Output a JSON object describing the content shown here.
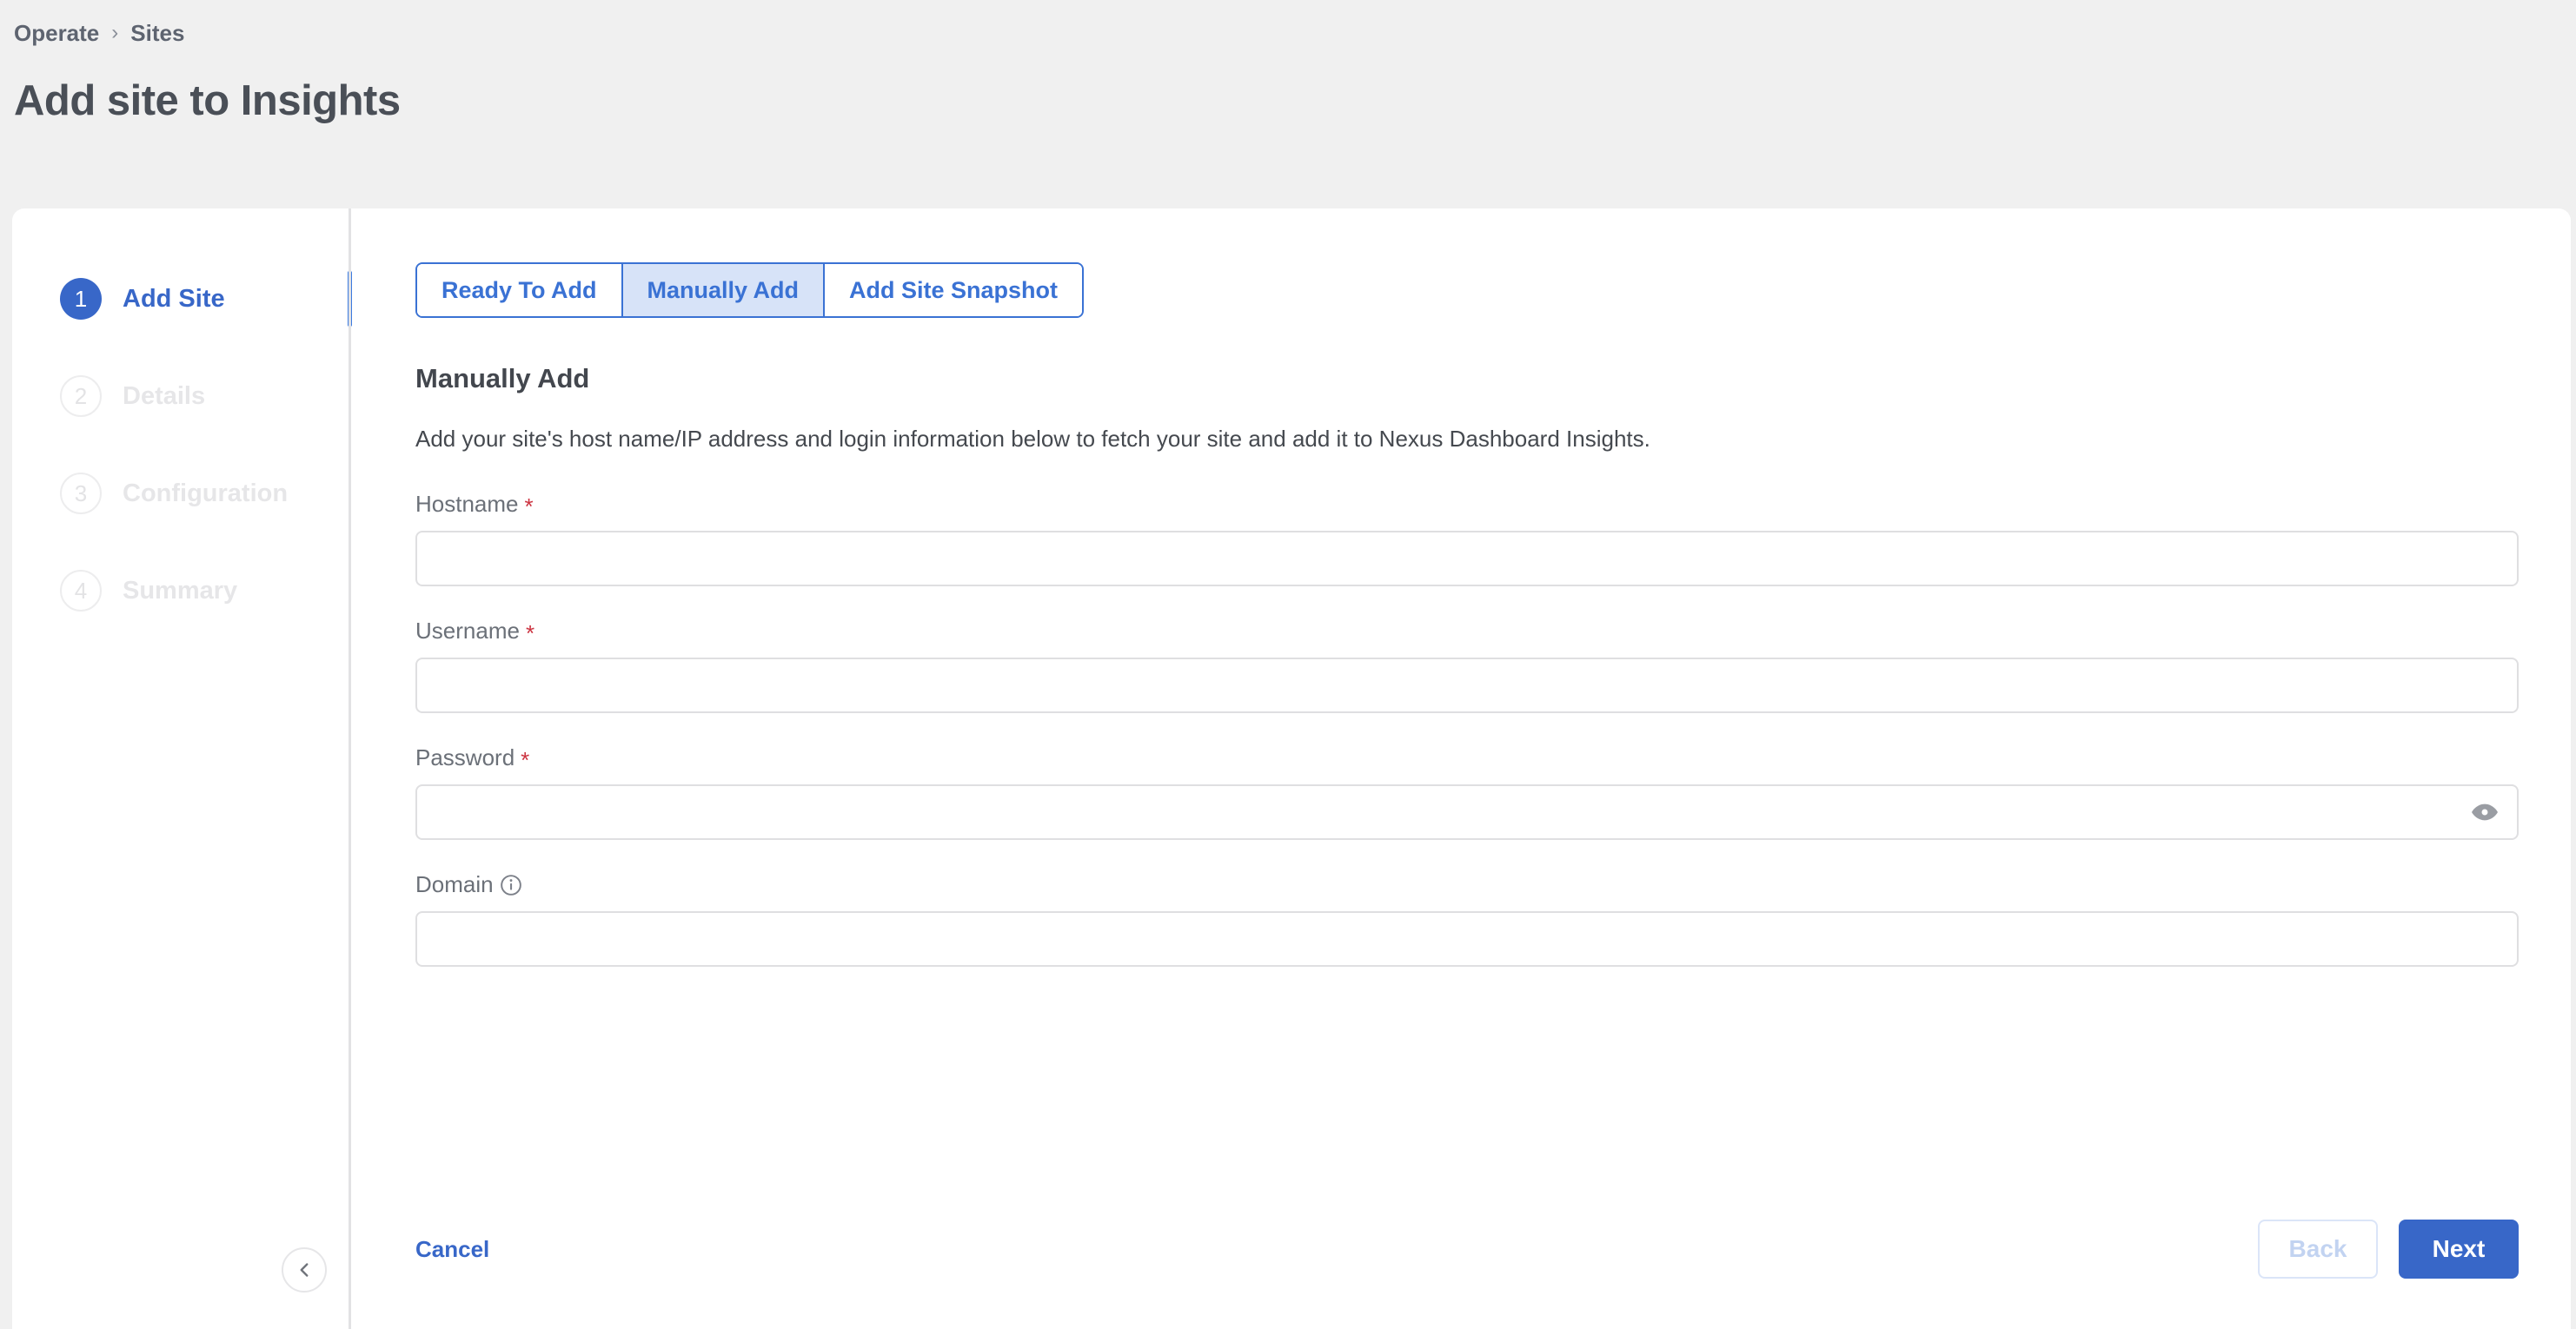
{
  "breadcrumb": {
    "items": [
      "Operate",
      "Sites"
    ],
    "separator": "›"
  },
  "page": {
    "title": "Add site to Insights"
  },
  "wizard": {
    "steps": [
      {
        "number": "1",
        "label": "Add Site",
        "state": "active"
      },
      {
        "number": "2",
        "label": "Details",
        "state": "inactive"
      },
      {
        "number": "3",
        "label": "Configuration",
        "state": "inactive"
      },
      {
        "number": "4",
        "label": "Summary",
        "state": "inactive"
      }
    ],
    "collapse_icon": "chevron-left-icon"
  },
  "tabs": [
    {
      "label": "Ready To Add",
      "selected": false
    },
    {
      "label": "Manually Add",
      "selected": true
    },
    {
      "label": "Add Site Snapshot",
      "selected": false
    }
  ],
  "section": {
    "title": "Manually Add",
    "description": "Add your site's host name/IP address and login information below to fetch your site and add it to Nexus Dashboard Insights."
  },
  "form": {
    "hostname": {
      "label": "Hostname",
      "required": "*",
      "value": "",
      "placeholder": ""
    },
    "username": {
      "label": "Username",
      "required": "*",
      "value": "",
      "placeholder": ""
    },
    "password": {
      "label": "Password",
      "required": "*",
      "value": "",
      "placeholder": "",
      "toggle_icon": "eye-icon"
    },
    "domain": {
      "label": "Domain",
      "required": "",
      "value": "",
      "placeholder": "",
      "info_icon": "info-circle-icon"
    }
  },
  "footer": {
    "cancel_label": "Cancel",
    "back_label": "Back",
    "next_label": "Next"
  },
  "colors": {
    "accent_blue": "#3867c8",
    "tab_blue": "#3a72d4",
    "tab_selected_bg": "#d7e3f8",
    "required_red": "#cc3340",
    "page_bg": "#f0f0f0",
    "card_bg": "#ffffff",
    "muted_grey": "#e6e6e8"
  }
}
